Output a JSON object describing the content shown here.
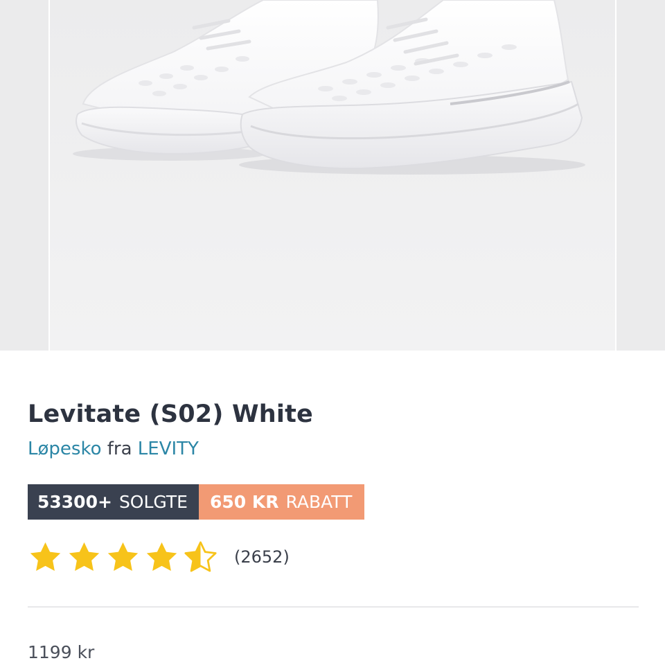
{
  "product": {
    "title": "Levitate (S02) White",
    "category_link": "Løpesko",
    "from_text": "fra",
    "brand_link": "LEVITY",
    "price": "1199 kr"
  },
  "badges": {
    "sold_count": "53300+",
    "sold_label": "SOLGTE",
    "discount_amount": "650 KR",
    "discount_label": "RABATT"
  },
  "rating": {
    "stars": 4.5,
    "max_stars": 5,
    "count": "(2652)"
  },
  "colors": {
    "title": "#2d3340",
    "link": "#2b86a6",
    "sold_badge_bg": "#3a4150",
    "discount_badge_bg": "#f29a74",
    "star": "#f7c31a"
  },
  "icons": {
    "star_full": "star-icon",
    "star_half": "star-half-icon"
  }
}
